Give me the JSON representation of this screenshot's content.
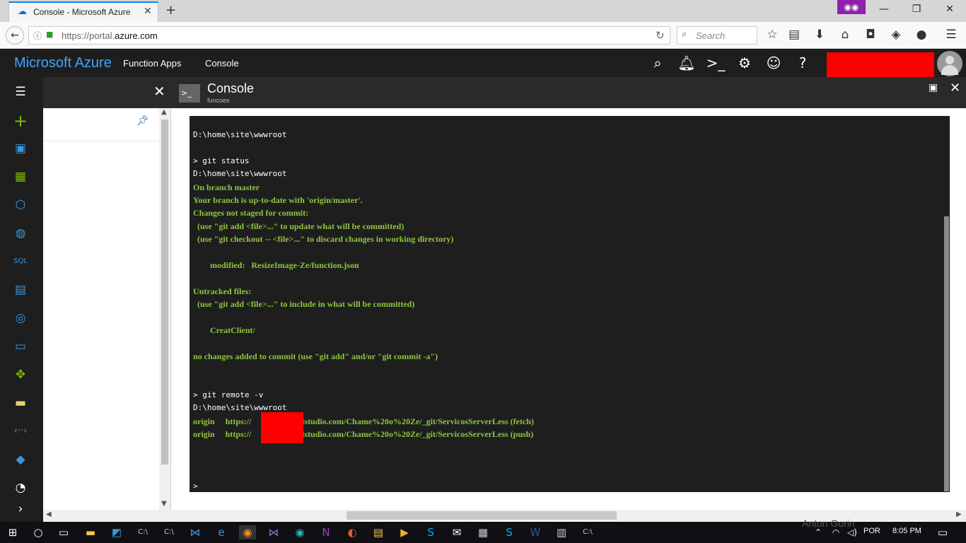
{
  "browser": {
    "tab_title": "Console - Microsoft Azure",
    "url_prefix": "https://portal.",
    "url_domain": "azure.com",
    "search_placeholder": "Search"
  },
  "azure": {
    "brand": "Microsoft Azure",
    "breadcrumbs": [
      "Function Apps",
      "Console"
    ],
    "header_icons": [
      "search-icon",
      "bell-icon",
      "shell-icon",
      "gear-icon",
      "smiley-icon",
      "help-icon"
    ]
  },
  "sidebar": {
    "items": [
      "menu-icon",
      "plus-icon",
      "dashboard-icon",
      "grid-icon",
      "cube-icon",
      "globe-icon",
      "sql-icon",
      "storage-icon",
      "planet-icon",
      "monitor-icon",
      "diamond-icon",
      "card-icon",
      "dots-icon",
      "git-icon",
      "gauge-icon",
      "chevron-right-icon"
    ]
  },
  "console": {
    "title": "Console",
    "subtitle": "funcoes",
    "lines": [
      {
        "text": "D:\\home\\site\\wwwroot",
        "c": "w"
      },
      {
        "text": "",
        "c": "w"
      },
      {
        "text": "> git status",
        "c": "w"
      },
      {
        "text": "D:\\home\\site\\wwwroot",
        "c": "w"
      },
      {
        "text": "On branch master",
        "c": "g"
      },
      {
        "text": "Your branch is up-to-date with 'origin/master'.",
        "c": "g"
      },
      {
        "text": "Changes not staged for commit:",
        "c": "g"
      },
      {
        "text": "  (use \"git add <file>...\" to update what will be committed)",
        "c": "g"
      },
      {
        "text": "  (use \"git checkout -- <file>...\" to discard changes in working directory)",
        "c": "g"
      },
      {
        "text": "",
        "c": "g"
      },
      {
        "text": "        modified:   ResizeImage-Ze/function.json",
        "c": "g"
      },
      {
        "text": "",
        "c": "g"
      },
      {
        "text": "Untracked files:",
        "c": "g"
      },
      {
        "text": "  (use \"git add <file>...\" to include in what will be committed)",
        "c": "g"
      },
      {
        "text": "",
        "c": "g"
      },
      {
        "text": "        CreatClient/",
        "c": "g"
      },
      {
        "text": "",
        "c": "g"
      },
      {
        "text": "no changes added to commit (use \"git add\" and/or \"git commit -a\")",
        "c": "g"
      },
      {
        "text": "",
        "c": "g"
      },
      {
        "text": "",
        "c": "g"
      },
      {
        "text": "> git remote -v",
        "c": "w"
      },
      {
        "text": "D:\\home\\site\\wwwroot",
        "c": "w"
      },
      {
        "text": "origin     https://              .visualstudio.com/Chame%20o%20Ze/_git/ServicosServerLess (fetch)",
        "c": "g"
      },
      {
        "text": "origin     https://              .visualstudio.com/Chame%20o%20Ze/_git/ServicosServerLess (push)",
        "c": "g"
      },
      {
        "text": "",
        "c": "g"
      },
      {
        "text": "",
        "c": "g"
      },
      {
        "text": "",
        "c": "g"
      },
      {
        "text": ">",
        "c": "w"
      }
    ]
  },
  "taskbar": {
    "watermark": "Anton Gorin",
    "language": "POR",
    "time": "8:05 PM"
  }
}
